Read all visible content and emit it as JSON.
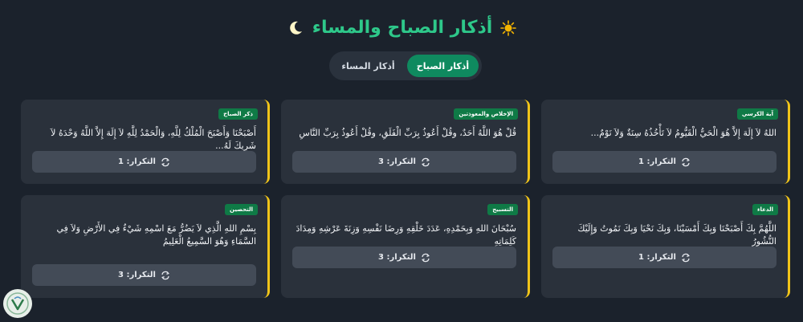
{
  "header": {
    "title": "أذكار الصباح والمساء",
    "sun_icon": "sun-icon",
    "moon_icon": "moon-icon"
  },
  "tabs": [
    {
      "label": "أذكار الصباح",
      "active": true
    },
    {
      "label": "أذكار المساء",
      "active": false
    }
  ],
  "cards": [
    {
      "category": "آية الكرسي",
      "text": "اللهُ لاَ إِلَهَ إِلاَّ هُوَ الْحَيُّ الْقَيُّومُ لاَ تَأْخُذُهُ سِنَةٌ وَلاَ نَوْمٌ...",
      "count_label": "التكرار: 1"
    },
    {
      "category": "الإخلاص والمعوذتين",
      "text": "قُلْ هُوَ اللَّهُ أَحَدٌ، وقُلْ أَعُوذُ بِرَبِّ الْفَلَقِ، وقُلْ أَعُوذُ بِرَبِّ النَّاسِ",
      "count_label": "التكرار: 3"
    },
    {
      "category": "ذكر الصباح",
      "text": "أَصْبَحْنَا وَأَصْبَحَ الْمُلْكُ لِلَّهِ، وَالْحَمْدُ لِلَّهِ لاَ إِلَهَ إِلاَّ اللَّهُ وَحْدَهُ لاَ شَرِيكَ لَهُ...",
      "count_label": "التكرار: 1"
    },
    {
      "category": "الدعاء",
      "text": "اللَّهُمَّ بِكَ أَصْبَحْنَا وَبِكَ أَمْسَيْنَا، وَبِكَ نَحْيَا وَبِكَ نَمُوتُ وَإِلَيْكَ النُّشُورُ",
      "count_label": "التكرار: 1"
    },
    {
      "category": "التسبيح",
      "text": "سُبْحَانَ اللهِ وَبِحَمْدِهِ، عَدَدَ خَلْقِهِ وَرِضَا نَفْسِهِ وَزِنَةَ عَرْشِهِ وَمِدَادَ كَلِمَاتِهِ",
      "count_label": "التكرار: 3"
    },
    {
      "category": "التحصين",
      "text": "بِسْمِ اللهِ الَّذِي لاَ يَضُرُّ مَعَ اسْمِهِ شَيْءٌ فِي الأَرْضِ وَلاَ فِي السَّمَاءِ وَهُوَ السَّمِيعُ الْعَلِيمُ",
      "count_label": "التكرار: 3"
    }
  ],
  "colors": {
    "background": "#1b222c",
    "card": "#2a313b",
    "accent_green": "#2ec88a",
    "badge_green": "#0f7a46",
    "card_border": "#f0c419",
    "button": "#434b57"
  },
  "icons": {
    "count_button": "repeat-icon",
    "logo": "logo-icon"
  }
}
